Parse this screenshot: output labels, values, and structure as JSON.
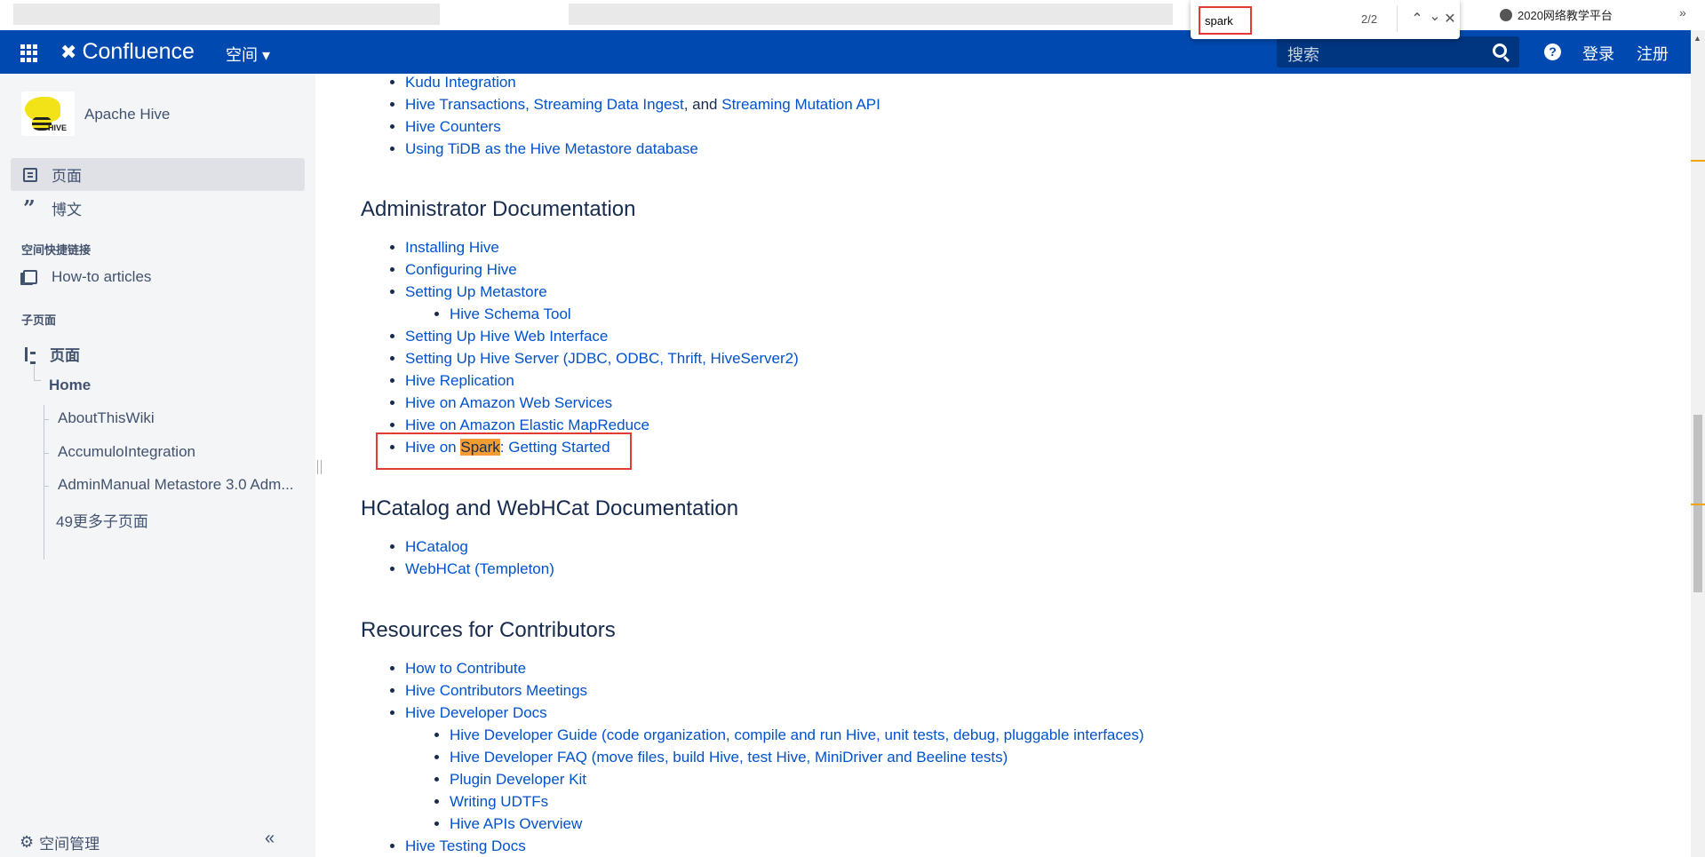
{
  "browser": {
    "bookmark": "2020网络教学平台",
    "more": "»"
  },
  "find": {
    "query": "spark",
    "count": "2/2"
  },
  "header": {
    "product": "Confluence",
    "spaces": "空间 ▾",
    "search_placeholder": "搜索",
    "help": "?",
    "login": "登录",
    "signup": "注册",
    "color": "#0049b0"
  },
  "sidebar": {
    "space_name": "Apache Hive",
    "nav": [
      {
        "label": "页面",
        "selected": true
      },
      {
        "label": "博文"
      }
    ],
    "shortcuts_title": "空间快捷链接",
    "shortcuts": [
      {
        "label": "How-to articles"
      }
    ],
    "children_title": "子页面",
    "tree_root": "页面",
    "home": "Home",
    "children": [
      "AboutThisWiki",
      "AccumuloIntegration",
      "AdminManual Metastore 3.0 Adm..."
    ],
    "more": "49更多子页面",
    "space_admin": "空间管理",
    "collapse": "«"
  },
  "content": {
    "top_items": [
      {
        "link": "Kudu Integration"
      },
      {
        "link": "Hive Transactions, Streaming Data Ingest",
        "plain": ", and ",
        "link2": "Streaming Mutation API"
      },
      {
        "link": "Hive Counters"
      },
      {
        "link": "Using TiDB as the Hive Metastore database"
      }
    ],
    "admin": {
      "title": "Administrator Documentation",
      "items": [
        "Installing Hive",
        "Configuring Hive",
        "Setting Up Metastore",
        "Hive Schema Tool",
        "Setting Up Hive Web Interface",
        "Setting Up Hive Server (JDBC, ODBC, Thrift, HiveServer2)",
        "Hive Replication",
        "Hive on Amazon Web Services",
        "Hive on Amazon Elastic MapReduce"
      ],
      "spark_item": {
        "pre": "Hive on ",
        "match": "Spark",
        "post": ": Getting Started"
      }
    },
    "hcat": {
      "title": "HCatalog and WebHCat Documentation",
      "items": [
        "HCatalog",
        "WebHCat (Templeton)"
      ]
    },
    "contrib": {
      "title": "Resources for Contributors",
      "items": [
        "How to Contribute",
        "Hive Contributors Meetings",
        "Hive Developer Docs",
        "Hive Developer Guide (code organization, compile and run Hive, unit tests, debug, pluggable interfaces)",
        "Hive Developer FAQ (move files, build Hive, test Hive, MiniDriver and Beeline tests)",
        "Plugin Developer Kit",
        "Writing UDTFs",
        "Hive APIs Overview",
        "Hive Testing Docs"
      ]
    }
  },
  "colors": {
    "link": "#0052cc",
    "highlight": "#f39c33",
    "annotation": "#e53935"
  }
}
